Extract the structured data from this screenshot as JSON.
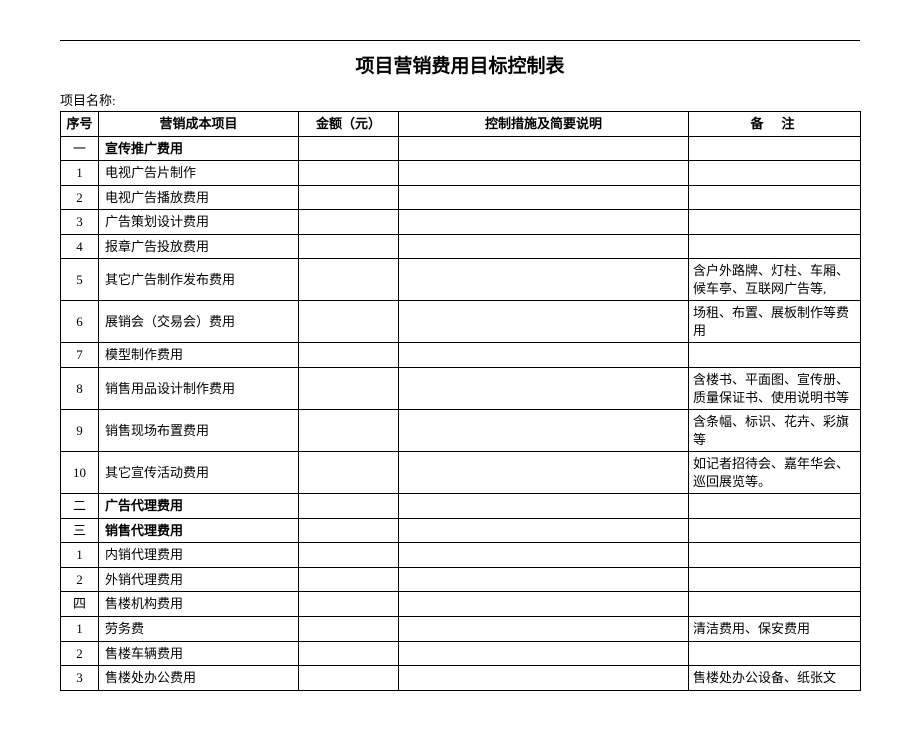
{
  "title": "项目营销费用目标控制表",
  "project_label": "项目名称:",
  "headers": {
    "seq": "序号",
    "item": "营销成本项目",
    "amount": "金额（元）",
    "control": "控制措施及简要说明",
    "remark": "备注"
  },
  "rows": [
    {
      "seq": "一",
      "item": "宣传推广费用",
      "amount": "",
      "control": "",
      "remark": "",
      "section": true
    },
    {
      "seq": "1",
      "item": "电视广告片制作",
      "amount": "",
      "control": "",
      "remark": ""
    },
    {
      "seq": "2",
      "item": "电视广告播放费用",
      "amount": "",
      "control": "",
      "remark": ""
    },
    {
      "seq": "3",
      "item": "广告策划设计费用",
      "amount": "",
      "control": "",
      "remark": ""
    },
    {
      "seq": "4",
      "item": "报章广告投放费用",
      "amount": "",
      "control": "",
      "remark": ""
    },
    {
      "seq": "5",
      "item": "其它广告制作发布费用",
      "amount": "",
      "control": "",
      "remark": "含户外路牌、灯柱、车厢、候车亭、互联网广告等,"
    },
    {
      "seq": "6",
      "item": "展销会（交易会）费用",
      "amount": "",
      "control": "",
      "remark": "场租、布置、展板制作等费用"
    },
    {
      "seq": "7",
      "item": "模型制作费用",
      "amount": "",
      "control": "",
      "remark": ""
    },
    {
      "seq": "8",
      "item": "销售用品设计制作费用",
      "amount": "",
      "control": "",
      "remark": "含楼书、平面图、宣传册、质量保证书、使用说明书等"
    },
    {
      "seq": "9",
      "item": "销售现场布置费用",
      "amount": "",
      "control": "",
      "remark": "含条幅、标识、花卉、彩旗等"
    },
    {
      "seq": "10",
      "item": "其它宣传活动费用",
      "amount": "",
      "control": "",
      "remark": "如记者招待会、嘉年华会、巡回展览等。"
    },
    {
      "seq": "二",
      "item": "广告代理费用",
      "amount": "",
      "control": "",
      "remark": "",
      "section": true
    },
    {
      "seq": "三",
      "item": "销售代理费用",
      "amount": "",
      "control": "",
      "remark": "",
      "section": true
    },
    {
      "seq": "1",
      "item": "内销代理费用",
      "amount": "",
      "control": "",
      "remark": ""
    },
    {
      "seq": "2",
      "item": "外销代理费用",
      "amount": "",
      "control": "",
      "remark": ""
    },
    {
      "seq": "四",
      "item": "售楼机构费用",
      "amount": "",
      "control": "",
      "remark": ""
    },
    {
      "seq": "1",
      "item": "劳务费",
      "amount": "",
      "control": "",
      "remark": "清洁费用、保安费用"
    },
    {
      "seq": "2",
      "item": "售楼车辆费用",
      "amount": "",
      "control": "",
      "remark": ""
    },
    {
      "seq": "3",
      "item": "售楼处办公费用",
      "amount": "",
      "control": "",
      "remark": "售楼处办公设备、纸张文"
    }
  ]
}
